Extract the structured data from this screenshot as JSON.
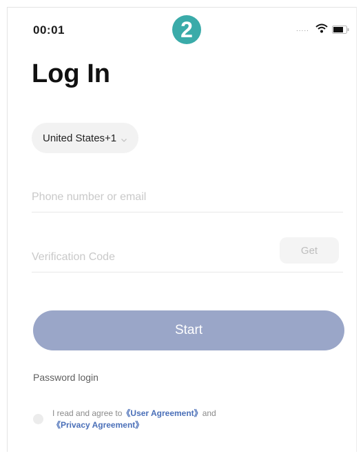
{
  "status_bar": {
    "time": "00:01",
    "step_number": "2",
    "signal_text": "....."
  },
  "page": {
    "title": "Log In"
  },
  "country_picker": {
    "label": "United States+1"
  },
  "phone_field": {
    "placeholder": "Phone number or email",
    "value": ""
  },
  "code_field": {
    "placeholder": "Verification Code",
    "value": "",
    "get_label": "Get"
  },
  "start_button": {
    "label": "Start"
  },
  "password_login": {
    "label": "Password login"
  },
  "agreement": {
    "prefix": "I read and agree to",
    "user_agreement": "《User Agreement》",
    "and": "and",
    "privacy_agreement": "《Privacy Agreement》",
    "checked": false
  },
  "colors": {
    "step_badge": "#3aaba9",
    "start_button": "#9aa6c8",
    "link": "#4a6fb8"
  }
}
